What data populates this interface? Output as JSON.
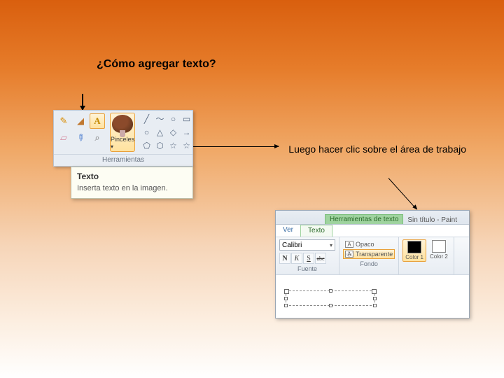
{
  "title": "¿Cómo agregar texto?",
  "instruction": "Luego hacer clic sobre el área de trabajo",
  "panelA": {
    "tools": {
      "pencil": "✎",
      "fill": "◢",
      "text": "A",
      "eraser": "▱",
      "picker": "✎",
      "magnifier": "⌕"
    },
    "brush_label": "Pinceles",
    "group_label": "Herramientas",
    "shapes": [
      "╱",
      "〜",
      "○",
      "▭",
      "○",
      "△",
      "◇",
      "→",
      "⬠",
      "⬡",
      "☆",
      "☆"
    ]
  },
  "tooltip": {
    "title": "Texto",
    "body": "Inserta texto en la imagen."
  },
  "panelB": {
    "context_tab": "Herramientas de texto",
    "window_title": "Sin título - Paint",
    "tabs": {
      "view": "Ver",
      "text": "Texto"
    },
    "font": {
      "name": "Calibri",
      "buttons": {
        "bold": "N",
        "italic": "K",
        "underline": "S",
        "strike": "abc"
      },
      "group_label": "Fuente"
    },
    "background": {
      "opaque": "Opaco",
      "transparent": "Transparente",
      "group_label": "Fondo"
    },
    "colors": {
      "c1_label": "Color 1",
      "c2_label": "Color 2",
      "c1": "#000000",
      "c2": "#ffffff"
    }
  }
}
